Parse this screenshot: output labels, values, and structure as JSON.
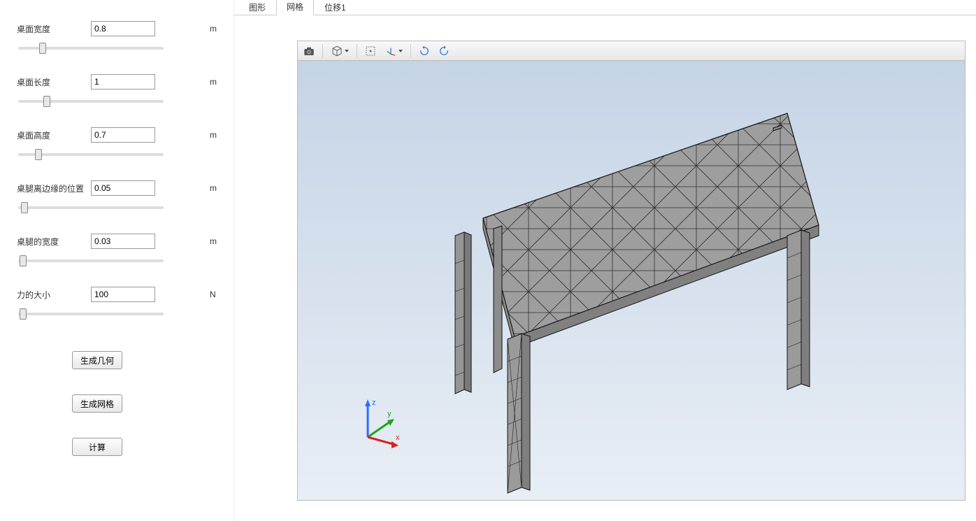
{
  "sidebar": {
    "params": [
      {
        "label": "桌面宽度",
        "value": "0.8",
        "unit": "m",
        "slider": 15
      },
      {
        "label": "桌面长度",
        "value": "1",
        "unit": "m",
        "slider": 18
      },
      {
        "label": "桌面高度",
        "value": "0.7",
        "unit": "m",
        "slider": 12
      },
      {
        "label": "桌腿离边缘的位置",
        "value": "0.05",
        "unit": "m",
        "slider": 2
      },
      {
        "label": "桌腿的宽度",
        "value": "0.03",
        "unit": "m",
        "slider": 1
      },
      {
        "label": "力的大小",
        "value": "100",
        "unit": "N",
        "slider": 1
      }
    ],
    "buttons": {
      "generate_geometry": "生成几何",
      "generate_mesh": "生成网格",
      "compute": "计算"
    }
  },
  "tabs": [
    {
      "id": "graphics",
      "label": "图形",
      "active": false
    },
    {
      "id": "mesh",
      "label": "网格",
      "active": true
    },
    {
      "id": "disp1",
      "label": "位移1",
      "active": false
    }
  ],
  "toolbar_icons": [
    "camera-icon",
    "cube-view-icon",
    "select-icon",
    "axis-xyz-icon",
    "rotate-cw-icon",
    "rotate-ccw-icon"
  ],
  "triad": {
    "x_label": "x",
    "y_label": "y",
    "z_label": "z"
  }
}
